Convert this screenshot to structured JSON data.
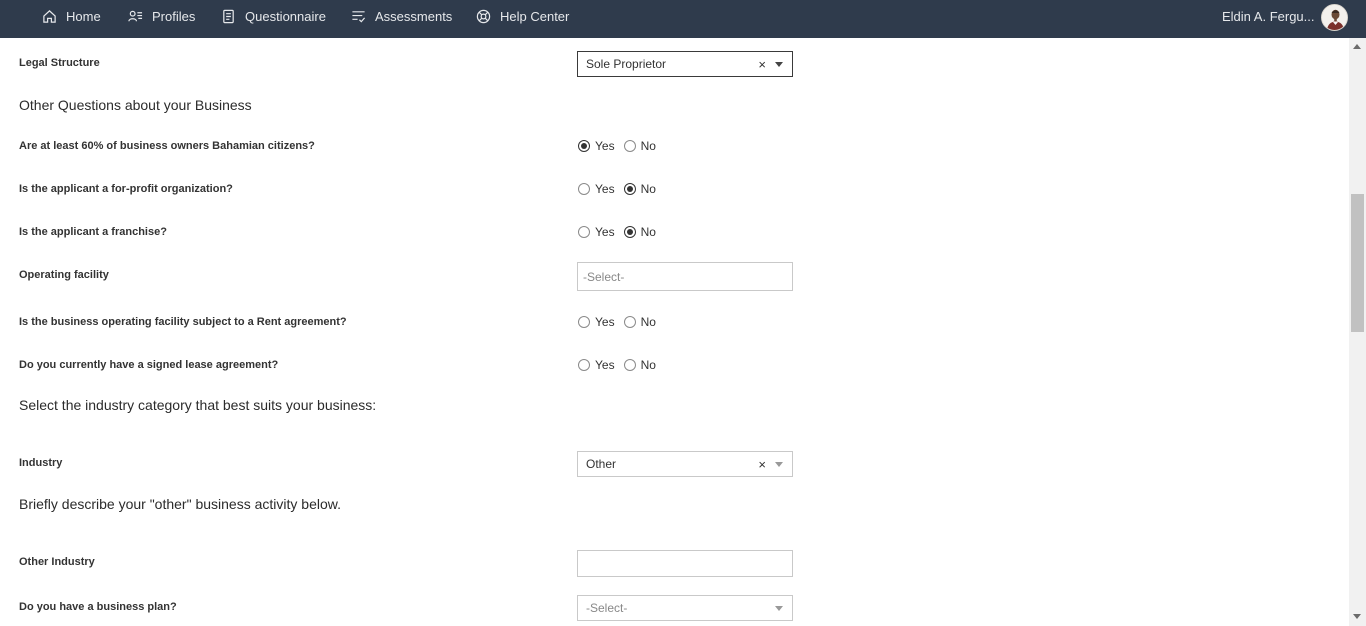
{
  "nav": {
    "items": [
      {
        "label": "Home",
        "icon": "home-icon"
      },
      {
        "label": "Profiles",
        "icon": "profiles-icon"
      },
      {
        "label": "Questionnaire",
        "icon": "questionnaire-icon"
      },
      {
        "label": "Assessments",
        "icon": "assessments-icon"
      },
      {
        "label": "Help Center",
        "icon": "help-center-icon"
      }
    ],
    "user_name": "Eldin A. Fergu..."
  },
  "form": {
    "legal_structure": {
      "label": "Legal Structure",
      "value": "Sole Proprietor",
      "clear": "×"
    },
    "other_questions_title": "Other Questions about your Business",
    "bahamian_citizens": {
      "label": "Are at least 60% of business owners Bahamian citizens?",
      "yes": "Yes",
      "no": "No",
      "selected": "Yes"
    },
    "for_profit": {
      "label": "Is the applicant a for-profit organization?",
      "yes": "Yes",
      "no": "No",
      "selected": "No"
    },
    "franchise": {
      "label": "Is the applicant a franchise?",
      "yes": "Yes",
      "no": "No",
      "selected": "No"
    },
    "operating_facility": {
      "label": "Operating facility",
      "placeholder": "-Select-"
    },
    "rent_agreement": {
      "label": "Is the business operating facility subject to a Rent agreement?",
      "yes": "Yes",
      "no": "No",
      "selected": ""
    },
    "signed_lease": {
      "label": "Do you currently have a signed lease agreement?",
      "yes": "Yes",
      "no": "No",
      "selected": ""
    },
    "industry_category_title": "Select the industry category that best suits your business:",
    "industry": {
      "label": "Industry",
      "value": "Other",
      "clear": "×"
    },
    "other_activity_title": "Briefly describe your \"other\" business activity below.",
    "other_industry": {
      "label": "Other Industry",
      "value": ""
    },
    "business_plan": {
      "label": "Do you have a business plan?",
      "placeholder": "-Select-"
    }
  },
  "colors": {
    "navbar": "#2f3b4c",
    "nav_text": "#e6e8eb"
  }
}
